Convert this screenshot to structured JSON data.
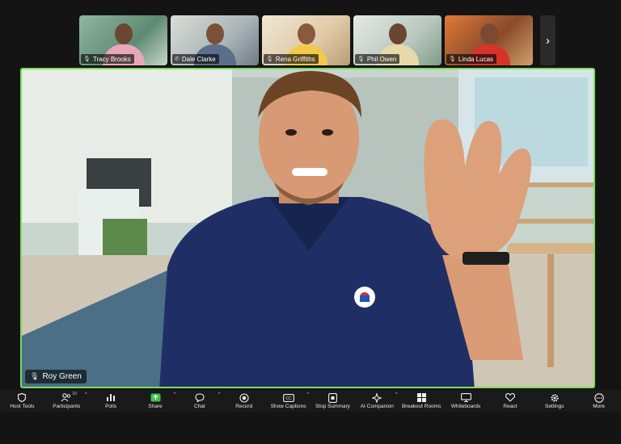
{
  "participants": [
    {
      "name": "Tracy Brooks"
    },
    {
      "name": "Dale Clarke"
    },
    {
      "name": "Rena Griffiths"
    },
    {
      "name": "Phil Owen"
    },
    {
      "name": "Linda Lucas"
    }
  ],
  "main_speaker": {
    "name": "Roy Green"
  },
  "toolbar": {
    "items": [
      {
        "label": "Host Tools",
        "icon": "shield-icon"
      },
      {
        "label": "Participants",
        "icon": "participants-icon",
        "badge": "10"
      },
      {
        "label": "Polls",
        "icon": "polls-icon"
      },
      {
        "label": "Share",
        "icon": "share-icon"
      },
      {
        "label": "Chat",
        "icon": "chat-icon"
      },
      {
        "label": "Record",
        "icon": "record-icon"
      },
      {
        "label": "Show Captions",
        "icon": "captions-icon"
      },
      {
        "label": "Stop Summary",
        "icon": "summary-icon"
      },
      {
        "label": "AI Companion",
        "icon": "ai-companion-icon"
      },
      {
        "label": "Breakout Rooms",
        "icon": "breakout-rooms-icon"
      },
      {
        "label": "Whiteboards",
        "icon": "whiteboards-icon"
      },
      {
        "label": "React",
        "icon": "react-icon"
      },
      {
        "label": "Settings",
        "icon": "gear-icon"
      },
      {
        "label": "More",
        "icon": "more-icon"
      }
    ]
  },
  "colors": {
    "active_speaker_border": "#7fdc5a",
    "share_green": "#3ec24a",
    "toolbar_bg": "#1a1a1a"
  }
}
